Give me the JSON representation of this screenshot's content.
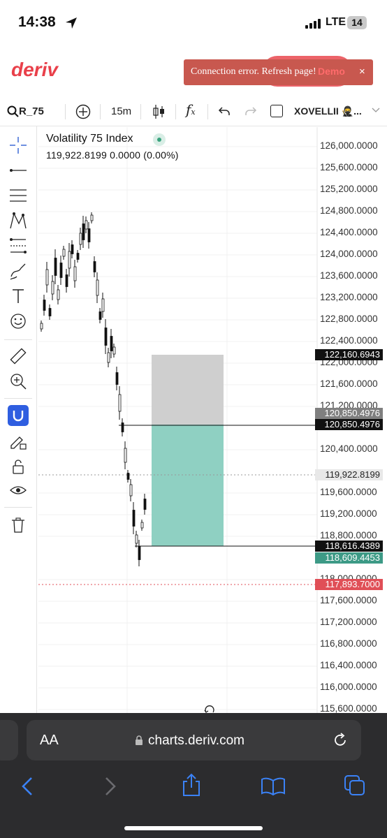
{
  "status_bar": {
    "time": "14:38",
    "network": "LTE",
    "battery": "14"
  },
  "header": {
    "logo": "deriv",
    "account_mode": "Demo"
  },
  "toast": {
    "message": "Connection error. Refresh page!",
    "close_label": "×"
  },
  "toolbar": {
    "symbol": "R_75",
    "interval": "15m",
    "account_name": "XOVELLII 🥷..."
  },
  "chart": {
    "title": "Volatility 75 Index",
    "quote": "119,922.8199 0.0000 (0.00%)",
    "price_axis": [
      "126,000.0000",
      "125,600.0000",
      "125,200.0000",
      "124,800.0000",
      "124,400.0000",
      "124,000.0000",
      "123,600.0000",
      "123,200.0000",
      "122,800.0000",
      "122,400.0000",
      "122,000.0000",
      "121,600.0000",
      "121,200.0000",
      "120,400.0000",
      "119,600.0000",
      "119,200.0000",
      "118,800.0000",
      "118,000.0000",
      "117,600.0000",
      "117,200.0000",
      "116,800.0000",
      "116,400.0000",
      "116,000.0000",
      "115,600.0000"
    ],
    "tags": {
      "take_profit": "122,160.6943",
      "entry_grey": "120,850.4976",
      "entry_black": "120,850.4976",
      "current": "119,922.8199",
      "stop_black": "118,616.4389",
      "stop_green": "118,609.4453",
      "barrier": "117,893.7000"
    },
    "colors": {
      "profit_zone": "#cfcfcf",
      "loss_zone": "#8fd0c2",
      "tag_green": "#3d9a86",
      "tag_red": "#e04f57",
      "tag_grey": "#7f7f7f"
    }
  },
  "browser": {
    "url": "charts.deriv.com",
    "text_size_label": "AA"
  }
}
